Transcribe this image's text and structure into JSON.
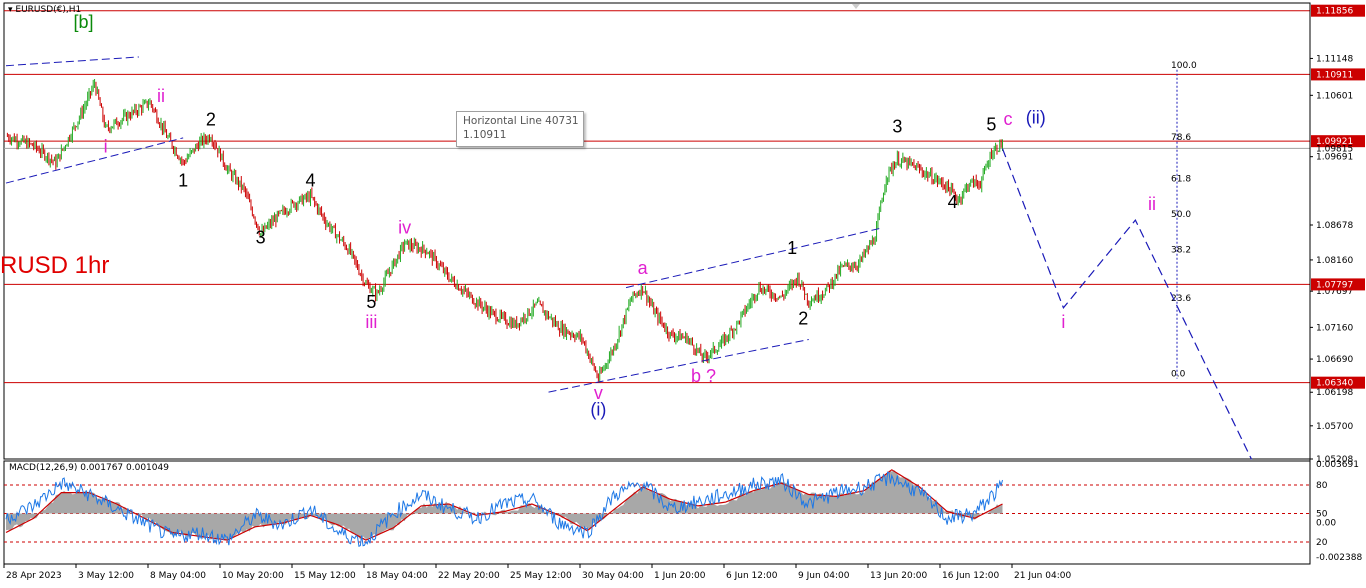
{
  "header": {
    "symbol": "EURUSD(€),H1"
  },
  "overlay_title": "RUSD 1hr",
  "tooltip": {
    "title": "Horizontal Line 40731",
    "value": "1.10911"
  },
  "price_axis": {
    "ticks": [
      "1.11148",
      "1.10601",
      "1.09691",
      "1.08678",
      "1.08160",
      "1.07697",
      "1.07160",
      "1.06690",
      "1.06198",
      "1.05700",
      "1.05208"
    ],
    "ylim": [
      1.05208,
      1.1197
    ]
  },
  "price_tags": [
    {
      "label": "1.11856",
      "value": 1.11856
    },
    {
      "label": "1.10911",
      "value": 1.10911
    },
    {
      "label": "1.09921",
      "value": 1.09921
    },
    {
      "label": "1.09815",
      "value": 1.09815
    },
    {
      "label": "1.07797",
      "value": 1.07797
    },
    {
      "label": "1.06340",
      "value": 1.0634
    }
  ],
  "horizontal_lines": [
    1.11856,
    1.10911,
    1.09921,
    1.07797,
    1.0634
  ],
  "current_price_line": 1.09815,
  "time_axis": {
    "labels": [
      "28 Apr 2023",
      "3 May 12:00",
      "8 May 04:00",
      "10 May 20:00",
      "15 May 12:00",
      "18 May 04:00",
      "22 May 20:00",
      "25 May 12:00",
      "30 May 04:00",
      "1 Jun 20:00",
      "6 Jun 12:00",
      "9 Jun 04:00",
      "13 Jun 20:00",
      "16 Jun 12:00",
      "21 Jun 04:00"
    ]
  },
  "fib_levels": [
    {
      "label": "100.0",
      "value": 1.1098
    },
    {
      "label": "78.6",
      "value": 1.0991
    },
    {
      "label": "61.8",
      "value": 1.0929
    },
    {
      "label": "50.0",
      "value": 1.0877
    },
    {
      "label": "38.2",
      "value": 1.0824
    },
    {
      "label": "23.6",
      "value": 1.0752
    },
    {
      "label": "0.0",
      "value": 1.064
    }
  ],
  "macd": {
    "label": "MACD(12,26,9) 0.001767 0.001049",
    "ticks": [
      "0.003691",
      "80",
      "50",
      "0.00",
      "20",
      "-0.002388"
    ],
    "levels": [
      80,
      50,
      20
    ]
  },
  "colors": {
    "candle_up": "#22aa22",
    "candle_down": "#cc0000",
    "level_line": "#cc0000",
    "trend_line": "#1a1ab8",
    "wave_magenta": "#e020d0",
    "wave_green": "#0a8a0a",
    "wave_blue": "#1a1ab8",
    "macd_line": "#1e78e6",
    "signal_line": "#cc0000",
    "histogram": "#a8a8a8"
  },
  "wave_labels": [
    {
      "text": "[b]",
      "color": "green",
      "x_index": 14,
      "price": 1.116
    },
    {
      "text": "ii",
      "color": "magenta",
      "x_index": 28,
      "price": 1.105
    },
    {
      "text": "i",
      "color": "magenta",
      "x_index": 18,
      "price": 1.0975
    },
    {
      "text": "2",
      "color": "black",
      "x_index": 37,
      "price": 1.1015
    },
    {
      "text": "1",
      "color": "black",
      "x_index": 32,
      "price": 1.0925
    },
    {
      "text": "4",
      "color": "black",
      "x_index": 55,
      "price": 1.0925
    },
    {
      "text": "3",
      "color": "black",
      "x_index": 46,
      "price": 1.084
    },
    {
      "text": "iv",
      "color": "magenta",
      "x_index": 72,
      "price": 1.0855
    },
    {
      "text": "5",
      "color": "black",
      "x_index": 66,
      "price": 1.0745
    },
    {
      "text": "iii",
      "color": "magenta",
      "x_index": 66,
      "price": 1.0715
    },
    {
      "text": "a",
      "color": "magenta",
      "x_index": 115,
      "price": 1.0795
    },
    {
      "text": "1",
      "color": "black",
      "x_index": 142,
      "price": 1.0825
    },
    {
      "text": "2",
      "color": "black",
      "x_index": 144,
      "price": 1.072
    },
    {
      "text": "b ?",
      "color": "magenta",
      "x_index": 126,
      "price": 1.0635
    },
    {
      "text": "v",
      "color": "magenta",
      "x_index": 107,
      "price": 1.061
    },
    {
      "text": "(i)",
      "color": "blue",
      "x_index": 107,
      "price": 1.0585
    },
    {
      "text": "3",
      "color": "black",
      "x_index": 161,
      "price": 1.1005
    },
    {
      "text": "4",
      "color": "black",
      "x_index": 171,
      "price": 1.0893
    },
    {
      "text": "5",
      "color": "black",
      "x_index": 178,
      "price": 1.1008
    },
    {
      "text": "c",
      "color": "magenta",
      "x_index": 181,
      "price": 1.1016
    },
    {
      "text": "(ii)",
      "color": "blue",
      "x_index": 186,
      "price": 1.1018
    },
    {
      "text": "i",
      "color": "magenta",
      "x_index": 191,
      "price": 1.0715
    },
    {
      "text": "ii",
      "color": "magenta",
      "x_index": 207,
      "price": 1.089
    }
  ],
  "trend_lines": [
    {
      "points": [
        [
          0,
          1.1104
        ],
        [
          24,
          1.1117
        ]
      ]
    },
    {
      "points": [
        [
          0,
          1.093
        ],
        [
          32,
          1.0997
        ]
      ]
    },
    {
      "points": [
        [
          98,
          1.062
        ],
        [
          145,
          1.0698
        ]
      ]
    },
    {
      "points": [
        [
          112,
          1.0775
        ],
        [
          158,
          1.0863
        ]
      ]
    }
  ],
  "projection": {
    "points": [
      [
        180,
        1.0981
      ],
      [
        191,
        1.0745
      ],
      [
        204,
        1.0875
      ],
      [
        225,
        1.052
      ]
    ]
  },
  "chart_data": {
    "type": "candlestick",
    "series_name": "EURUSD(€),H1",
    "ylim": [
      1.05208,
      1.1197
    ],
    "close_path": [
      [
        0,
        1.1
      ],
      [
        5,
        1.0985
      ],
      [
        9,
        1.096
      ],
      [
        14,
        1.104
      ],
      [
        16,
        1.1078
      ],
      [
        18,
        1.101
      ],
      [
        22,
        1.103
      ],
      [
        26,
        1.105
      ],
      [
        29,
        1.1
      ],
      [
        32,
        1.096
      ],
      [
        35,
        1.099
      ],
      [
        37,
        1.1
      ],
      [
        40,
        1.095
      ],
      [
        43,
        1.092
      ],
      [
        46,
        1.0855
      ],
      [
        49,
        1.088
      ],
      [
        52,
        1.09
      ],
      [
        55,
        1.091
      ],
      [
        58,
        1.087
      ],
      [
        62,
        1.083
      ],
      [
        65,
        1.078
      ],
      [
        67,
        1.0765
      ],
      [
        70,
        1.081
      ],
      [
        72,
        1.084
      ],
      [
        76,
        1.083
      ],
      [
        80,
        1.079
      ],
      [
        84,
        1.076
      ],
      [
        88,
        1.0735
      ],
      [
        92,
        1.072
      ],
      [
        96,
        1.075
      ],
      [
        100,
        1.0715
      ],
      [
        104,
        1.07
      ],
      [
        106,
        1.066
      ],
      [
        107,
        1.064
      ],
      [
        110,
        1.069
      ],
      [
        113,
        1.076
      ],
      [
        115,
        1.0775
      ],
      [
        117,
        1.074
      ],
      [
        120,
        1.0705
      ],
      [
        123,
        1.07
      ],
      [
        126,
        1.067
      ],
      [
        129,
        1.069
      ],
      [
        132,
        1.072
      ],
      [
        136,
        1.0775
      ],
      [
        140,
        1.076
      ],
      [
        143,
        1.079
      ],
      [
        145,
        1.0755
      ],
      [
        148,
        1.077
      ],
      [
        151,
        1.0805
      ],
      [
        154,
        1.081
      ],
      [
        157,
        1.085
      ],
      [
        159,
        1.094
      ],
      [
        161,
        1.0965
      ],
      [
        164,
        1.0955
      ],
      [
        167,
        1.094
      ],
      [
        170,
        1.0925
      ],
      [
        172,
        1.0905
      ],
      [
        174,
        1.093
      ],
      [
        176,
        1.093
      ],
      [
        178,
        1.0975
      ],
      [
        180,
        1.099
      ]
    ],
    "macd_path": [
      [
        0,
        45
      ],
      [
        5,
        58
      ],
      [
        10,
        82
      ],
      [
        15,
        70
      ],
      [
        20,
        55
      ],
      [
        25,
        40
      ],
      [
        30,
        25
      ],
      [
        35,
        30
      ],
      [
        40,
        22
      ],
      [
        45,
        48
      ],
      [
        50,
        38
      ],
      [
        55,
        55
      ],
      [
        60,
        30
      ],
      [
        65,
        20
      ],
      [
        70,
        50
      ],
      [
        75,
        70
      ],
      [
        80,
        55
      ],
      [
        85,
        45
      ],
      [
        90,
        60
      ],
      [
        95,
        65
      ],
      [
        100,
        40
      ],
      [
        105,
        30
      ],
      [
        110,
        70
      ],
      [
        115,
        82
      ],
      [
        120,
        55
      ],
      [
        125,
        62
      ],
      [
        130,
        70
      ],
      [
        135,
        80
      ],
      [
        140,
        85
      ],
      [
        145,
        60
      ],
      [
        150,
        72
      ],
      [
        155,
        78
      ],
      [
        160,
        88
      ],
      [
        165,
        72
      ],
      [
        170,
        45
      ],
      [
        175,
        50
      ],
      [
        180,
        80
      ]
    ],
    "signal_path": [
      [
        0,
        30
      ],
      [
        5,
        45
      ],
      [
        10,
        72
      ],
      [
        15,
        72
      ],
      [
        20,
        60
      ],
      [
        25,
        45
      ],
      [
        30,
        30
      ],
      [
        35,
        26
      ],
      [
        40,
        22
      ],
      [
        45,
        36
      ],
      [
        50,
        40
      ],
      [
        55,
        48
      ],
      [
        60,
        38
      ],
      [
        65,
        22
      ],
      [
        70,
        35
      ],
      [
        75,
        58
      ],
      [
        80,
        60
      ],
      [
        85,
        48
      ],
      [
        90,
        52
      ],
      [
        95,
        60
      ],
      [
        100,
        48
      ],
      [
        105,
        32
      ],
      [
        110,
        55
      ],
      [
        115,
        78
      ],
      [
        120,
        65
      ],
      [
        125,
        58
      ],
      [
        130,
        62
      ],
      [
        135,
        74
      ],
      [
        140,
        82
      ],
      [
        145,
        70
      ],
      [
        150,
        68
      ],
      [
        155,
        74
      ],
      [
        160,
        96
      ],
      [
        165,
        78
      ],
      [
        170,
        52
      ],
      [
        175,
        45
      ],
      [
        180,
        60
      ]
    ]
  }
}
